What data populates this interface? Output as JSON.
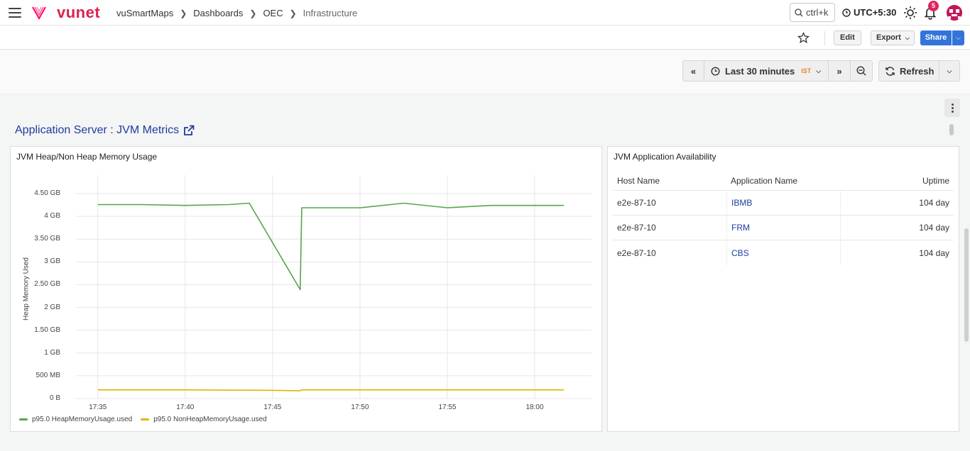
{
  "nav": {
    "logo_text": "vunet",
    "breadcrumbs": [
      "vuSmartMaps",
      "Dashboards",
      "OEC",
      "Infrastructure"
    ],
    "search_shortcut": "ctrl+k",
    "timezone": "UTC+5:30",
    "notification_count": "5",
    "brand_color": "#d8234e"
  },
  "actions": {
    "edit_label": "Edit",
    "export_label": "Export",
    "share_label": "Share"
  },
  "timepicker": {
    "range_label": "Last 30 minutes",
    "tz_badge": "IST",
    "refresh_label": "Refresh"
  },
  "section": {
    "title": "Application Server : JVM Metrics"
  },
  "heap_panel": {
    "title": "JVM Heap/Non Heap Memory Usage"
  },
  "chart_data": {
    "type": "line",
    "title": "JVM Heap/Non Heap Memory Usage",
    "ylabel": "Heap Memory Used",
    "xlabel": "",
    "y_unit": "GB",
    "ylim": [
      0,
      4.75
    ],
    "y_ticks": [
      {
        "v": 0,
        "label": "0 B"
      },
      {
        "v": 0.5,
        "label": "500 MB"
      },
      {
        "v": 1,
        "label": "1 GB"
      },
      {
        "v": 1.5,
        "label": "1.50 GB"
      },
      {
        "v": 2,
        "label": "2 GB"
      },
      {
        "v": 2.5,
        "label": "2.50 GB"
      },
      {
        "v": 3,
        "label": "3 GB"
      },
      {
        "v": 3.5,
        "label": "3.50 GB"
      },
      {
        "v": 4,
        "label": "4 GB"
      },
      {
        "v": 4.5,
        "label": "4.50 GB"
      }
    ],
    "x_ticks": [
      "17:35",
      "17:40",
      "17:45",
      "17:50",
      "17:55",
      "18:00"
    ],
    "x_range": [
      "17:33:45",
      "18:03:15"
    ],
    "grid": true,
    "legend_position": "bottom-left",
    "series": [
      {
        "name": "p95.0 HeapMemoryUsage.used",
        "color": "#56a64b",
        "points": [
          [
            "17:35:00",
            4.26
          ],
          [
            "17:37:30",
            4.26
          ],
          [
            "17:40:00",
            4.24
          ],
          [
            "17:42:30",
            4.26
          ],
          [
            "17:43:40",
            4.29
          ],
          [
            "17:46:35",
            2.39
          ],
          [
            "17:46:40",
            4.19
          ],
          [
            "17:50:00",
            4.19
          ],
          [
            "17:52:30",
            4.29
          ],
          [
            "17:55:00",
            4.19
          ],
          [
            "17:57:30",
            4.24
          ],
          [
            "18:00:00",
            4.24
          ],
          [
            "18:01:40",
            4.24
          ]
        ]
      },
      {
        "name": "p95.0 NonHeapMemoryUsage.used",
        "color": "#e0b400",
        "points": [
          [
            "17:35:00",
            0.19
          ],
          [
            "17:40:00",
            0.19
          ],
          [
            "17:45:00",
            0.18
          ],
          [
            "17:46:35",
            0.17
          ],
          [
            "17:46:40",
            0.19
          ],
          [
            "17:50:00",
            0.19
          ],
          [
            "17:55:00",
            0.19
          ],
          [
            "18:00:00",
            0.19
          ],
          [
            "18:01:40",
            0.19
          ]
        ]
      }
    ]
  },
  "availability_panel": {
    "title": "JVM Application Availability",
    "columns": [
      "Host Name",
      "Application Name",
      "Uptime"
    ],
    "rows": [
      {
        "host": "e2e-87-10",
        "app": "IBMB",
        "uptime": "104 day"
      },
      {
        "host": "e2e-87-10",
        "app": "FRM",
        "uptime": "104 day"
      },
      {
        "host": "e2e-87-10",
        "app": "CBS",
        "uptime": "104 day"
      }
    ]
  }
}
